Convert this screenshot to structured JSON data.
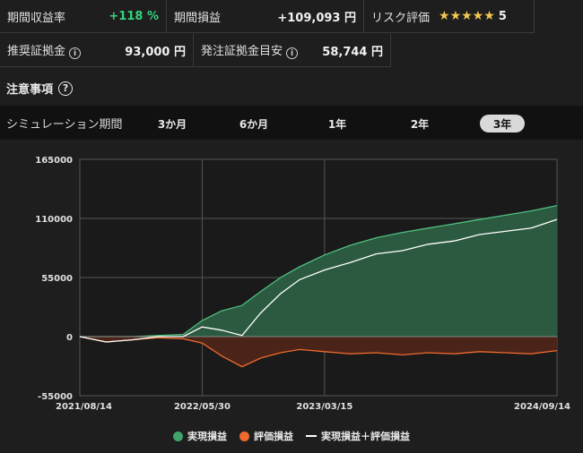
{
  "stats": {
    "return_rate_label": "期間収益率",
    "return_rate_value": "+118 %",
    "period_profit_label": "期間損益",
    "period_profit_value": "+109,093 円",
    "risk_label": "リスク評価",
    "risk_stars": "★★★★★",
    "risk_value": "5",
    "recommended_margin_label": "推奨証拠金",
    "recommended_margin_value": "93,000 円",
    "order_margin_label": "発注証拠金目安",
    "order_margin_value": "58,744 円"
  },
  "notice_label": "注意事項",
  "period": {
    "label": "シミュレーション期間",
    "options": [
      "3か月",
      "6か月",
      "1年",
      "2年",
      "3年"
    ],
    "selected": "3年"
  },
  "colors": {
    "realized": "#3fa46a",
    "valuation": "#ee6a2e",
    "total": "#ffffff"
  },
  "chart_data": {
    "type": "area",
    "x": [
      "2021/08/14",
      "2021/10/15",
      "2021/12/15",
      "2022/02/15",
      "2022/04/15",
      "2022/05/30",
      "2022/07/15",
      "2022/09/01",
      "2022/10/15",
      "2022/12/01",
      "2023/01/15",
      "2023/03/15",
      "2023/05/15",
      "2023/07/15",
      "2023/09/15",
      "2023/11/15",
      "2024/01/15",
      "2024/03/15",
      "2024/05/15",
      "2024/07/15",
      "2024/09/14"
    ],
    "series": [
      {
        "name": "実現損益",
        "values": [
          0,
          0,
          0,
          1000,
          2000,
          15000,
          24000,
          29000,
          42000,
          55000,
          65000,
          76000,
          85000,
          92000,
          97000,
          101000,
          105000,
          109000,
          113000,
          117000,
          122000
        ]
      },
      {
        "name": "評価損益",
        "values": [
          0,
          -5000,
          -3000,
          -1000,
          -2000,
          -6000,
          -18000,
          -28000,
          -20000,
          -15000,
          -12000,
          -14000,
          -16000,
          -15000,
          -17000,
          -15000,
          -16000,
          -14000,
          -15000,
          -16000,
          -13000
        ]
      },
      {
        "name": "実現損益＋評価損益",
        "values": [
          0,
          -5000,
          -3000,
          0,
          0,
          9000,
          6000,
          1000,
          22000,
          40000,
          53000,
          62000,
          69000,
          77000,
          80000,
          86000,
          89000,
          95000,
          98000,
          101000,
          109093
        ]
      }
    ],
    "xticks": [
      "2021/08/14",
      "2022/05/30",
      "2023/03/15",
      "2024/09/14"
    ],
    "yticks": [
      -55000,
      0,
      55000,
      110000,
      165000
    ],
    "ylim": [
      -55000,
      165000
    ],
    "grid": true,
    "legend": "bottom"
  }
}
